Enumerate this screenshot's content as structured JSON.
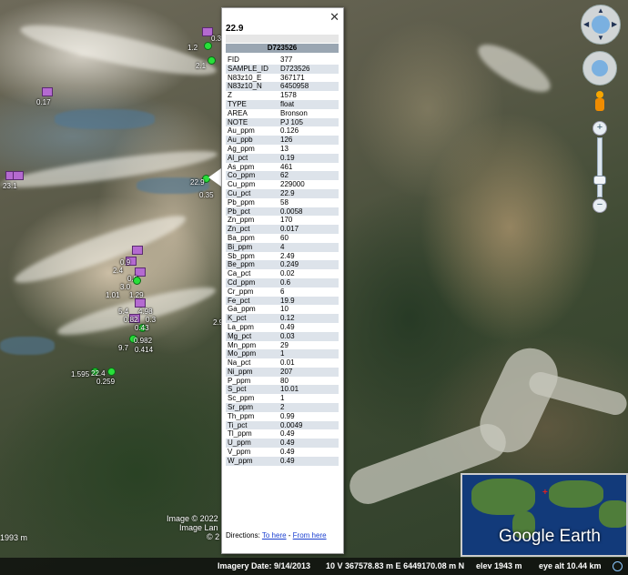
{
  "balloon": {
    "title": "22.9",
    "header": "D723526",
    "close_glyph": "✕",
    "rows": [
      [
        "FID",
        "377"
      ],
      [
        "SAMPLE_ID",
        "D723526"
      ],
      [
        "N83z10_E",
        "367171"
      ],
      [
        "N83z10_N",
        "6450958"
      ],
      [
        "Z",
        "1578"
      ],
      [
        "TYPE",
        "float"
      ],
      [
        "AREA",
        "Bronson"
      ],
      [
        "NOTE",
        "PJ 105"
      ],
      [
        "Au_ppm",
        "0.126"
      ],
      [
        "Au_ppb",
        "126"
      ],
      [
        "Ag_ppm",
        "13"
      ],
      [
        "Al_pct",
        "0.19"
      ],
      [
        "As_ppm",
        "461"
      ],
      [
        "Co_ppm",
        "62"
      ],
      [
        "Cu_ppm",
        "229000"
      ],
      [
        "Cu_pct",
        "22.9"
      ],
      [
        "Pb_ppm",
        "58"
      ],
      [
        "Pb_pct",
        "0.0058"
      ],
      [
        "Zn_ppm",
        "170"
      ],
      [
        "Zn_pct",
        "0.017"
      ],
      [
        "Ba_ppm",
        "60"
      ],
      [
        "Bi_ppm",
        "4"
      ],
      [
        "Sb_ppm",
        "2.49"
      ],
      [
        "Be_ppm",
        "0.249"
      ],
      [
        "Ca_pct",
        "0.02"
      ],
      [
        "Cd_ppm",
        "0.6"
      ],
      [
        "Cr_ppm",
        "6"
      ],
      [
        "Fe_pct",
        "19.9"
      ],
      [
        "Ga_ppm",
        "10"
      ],
      [
        "K_pct",
        "0.12"
      ],
      [
        "La_ppm",
        "0.49"
      ],
      [
        "Mg_pct",
        "0.03"
      ],
      [
        "Mn_ppm",
        "29"
      ],
      [
        "Mo_ppm",
        "1"
      ],
      [
        "Na_pct",
        "0.01"
      ],
      [
        "Ni_ppm",
        "207"
      ],
      [
        "P_ppm",
        "80"
      ],
      [
        "S_pct",
        "10.01"
      ],
      [
        "Sc_ppm",
        "1"
      ],
      [
        "Sr_ppm",
        "2"
      ],
      [
        "Th_ppm",
        "0.99"
      ],
      [
        "Ti_pct",
        "0.0049"
      ],
      [
        "Tl_ppm",
        "0.49"
      ],
      [
        "U_ppm",
        "0.49"
      ],
      [
        "V_ppm",
        "0.49"
      ],
      [
        "W_ppm",
        "0.49"
      ]
    ],
    "directions_label": "Directions:",
    "to_here": "To here",
    "from_here": "From here",
    "separator": " - "
  },
  "map_labels": [
    {
      "text": "1.2"
    },
    {
      "text": "0.3"
    },
    {
      "text": "2.1"
    },
    {
      "text": "0.17"
    },
    {
      "text": "23.1"
    },
    {
      "text": "22.9"
    },
    {
      "text": "0.35"
    },
    {
      "text": "0.9"
    },
    {
      "text": "2.4"
    },
    {
      "text": "0.9"
    },
    {
      "text": "3.0"
    },
    {
      "text": "1.01"
    },
    {
      "text": "1.29"
    },
    {
      "text": "5.4"
    },
    {
      "text": "4.98"
    },
    {
      "text": "0.82"
    },
    {
      "text": "0.3"
    },
    {
      "text": "0.43"
    },
    {
      "text": "2.9"
    },
    {
      "text": "0.982"
    },
    {
      "text": "9.7"
    },
    {
      "text": "0.414"
    },
    {
      "text": "1.595"
    },
    {
      "text": "22.4"
    },
    {
      "text": "0.259"
    }
  ],
  "attribution": {
    "line1": "Image © 2022",
    "line2": "Image Lan",
    "line3": "© 2"
  },
  "scale_label": "1993 m",
  "status": {
    "imagery_date": "Imagery Date: 9/14/2013",
    "coords": "10 V 367578.83 m E 6449170.08 m N",
    "elev": "elev 1943 m",
    "eye_alt": "eye alt 10.44 km"
  },
  "inset": {
    "logo": "Google Earth",
    "marker": "+"
  },
  "nav": {
    "zoom_in": "+",
    "zoom_out": "−",
    "arrows": [
      "▲",
      "▼",
      "◀",
      "▶"
    ]
  }
}
